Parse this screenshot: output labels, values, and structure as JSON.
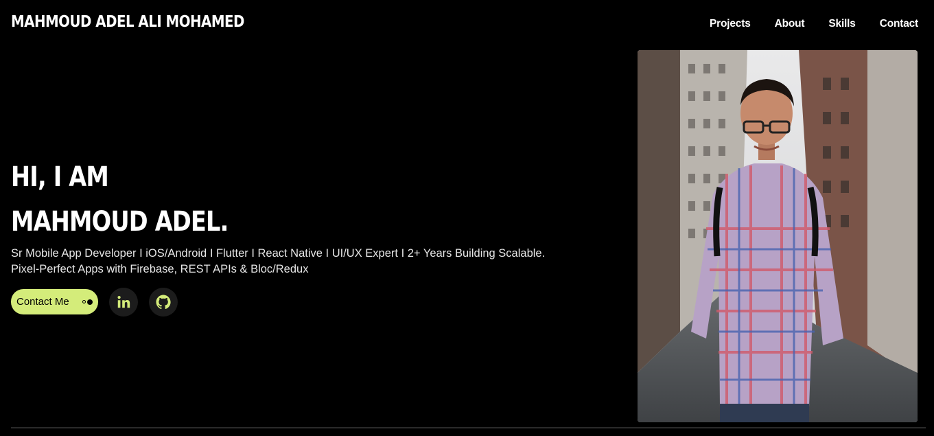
{
  "header": {
    "brand": "MAHMOUD ADEL ALI MOHAMED",
    "nav": [
      "Projects",
      "About",
      "Skills",
      "Contact"
    ]
  },
  "hero": {
    "greeting": "HI, I AM",
    "name": "MAHMOUD ADEL.",
    "tagline_line1": "Sr Mobile App Developer I iOS/Android I Flutter I React Native I UI/UX Expert I 2+ Years Building Scalable.",
    "tagline_line2": "Pixel-Perfect Apps with Firebase, REST APIs & Bloc/Redux",
    "contact_label": "Contact Me",
    "social": [
      {
        "icon": "linkedin-icon"
      },
      {
        "icon": "github-icon"
      }
    ]
  },
  "colors": {
    "background": "#000000",
    "accent": "#d4ec7a",
    "icon_circle": "#1c1c1c"
  }
}
